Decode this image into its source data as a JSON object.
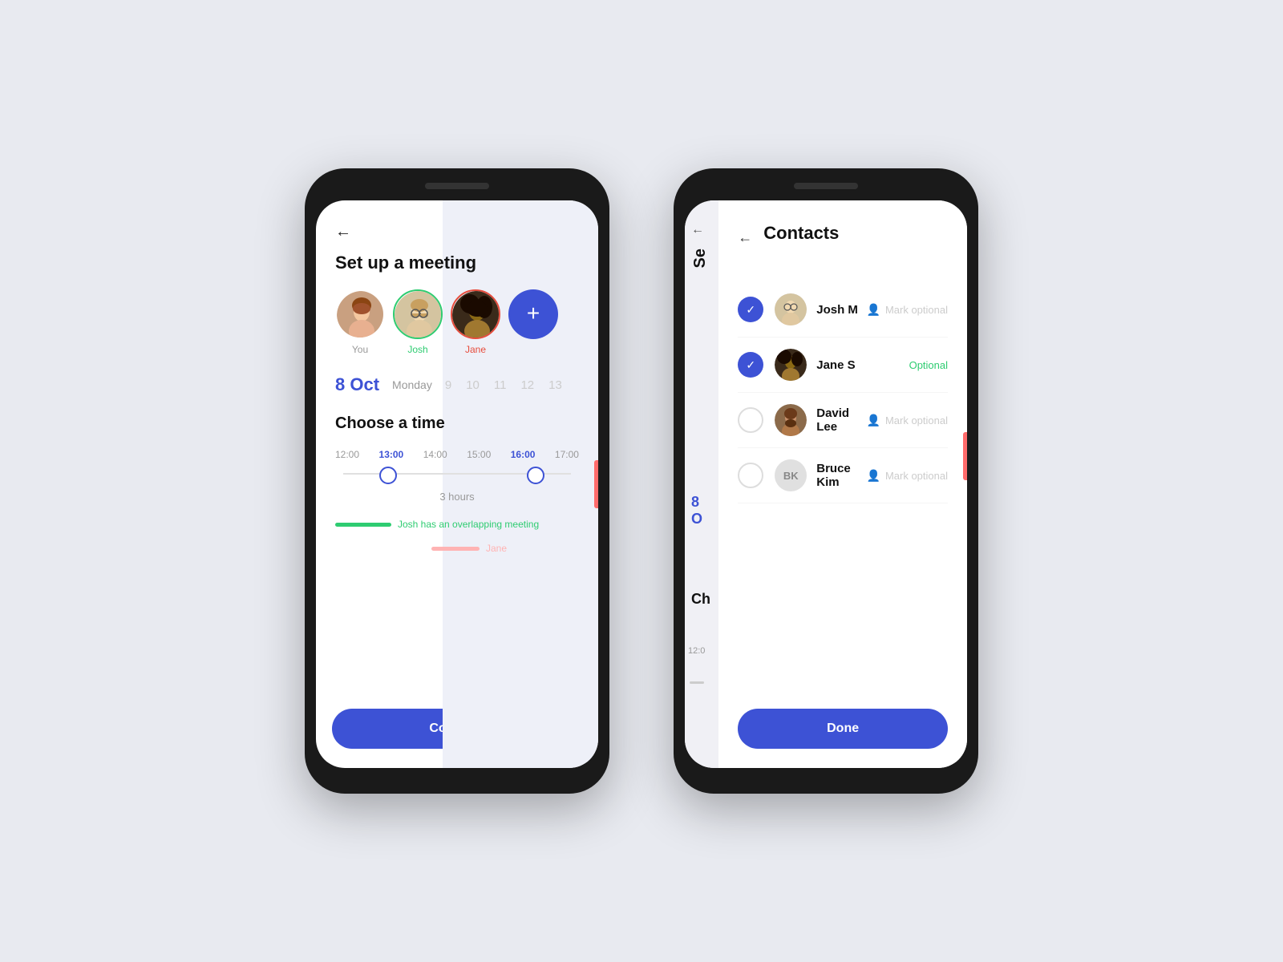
{
  "phone1": {
    "back_label": "←",
    "title": "Set up a meeting",
    "avatars": [
      {
        "id": "you",
        "label": "You",
        "label_class": "",
        "border_class": ""
      },
      {
        "id": "josh",
        "label": "Josh",
        "label_class": "green",
        "border_class": "border-green"
      },
      {
        "id": "jane",
        "label": "Jane",
        "label_class": "red",
        "border_class": "border-red"
      }
    ],
    "add_button_label": "+",
    "date": {
      "current": "8 Oct",
      "day": "Monday",
      "numbers": [
        "9",
        "10",
        "11",
        "12",
        "13"
      ]
    },
    "choose_time_label": "Choose a time",
    "time_labels": [
      "12:00",
      "13:00",
      "14:00",
      "15:00",
      "16:00",
      "17:00"
    ],
    "duration_label": "3 hours",
    "overlap_message": "Josh has an overlapping meeting",
    "jane_label": "Jane",
    "continue_label": "Continue"
  },
  "phone2": {
    "back_label": "←",
    "title": "Contacts",
    "bg_se": "Se",
    "bg_date": "8 O",
    "bg_ch": "Ch",
    "bg_time": "12:0",
    "contacts": [
      {
        "id": "josh-m",
        "name": "Josh M",
        "checked": true,
        "optional_label": "Mark optional",
        "optional_active": false
      },
      {
        "id": "jane-s",
        "name": "Jane S",
        "checked": true,
        "optional_label": "Optional",
        "optional_active": true
      },
      {
        "id": "david-lee",
        "name": "David Lee",
        "checked": false,
        "optional_label": "Mark optional",
        "optional_active": false
      },
      {
        "id": "bruce-kim",
        "name": "Bruce Kim",
        "initials": "BK",
        "checked": false,
        "optional_label": "Mark optional",
        "optional_active": false
      }
    ],
    "done_label": "Done"
  },
  "colors": {
    "accent": "#3d52d5",
    "green": "#2ecc71",
    "red": "#e74c3c",
    "pink": "#ffb3b3",
    "text_primary": "#111",
    "text_muted": "#999"
  }
}
